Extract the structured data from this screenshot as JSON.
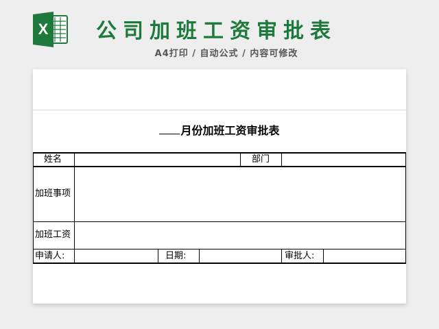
{
  "banner": {
    "title": "公司加班工资审批表",
    "subtitle": "A4打印 / 自动公式 / 内容可修改",
    "logo_letter": "X",
    "brand_color": "#1e7a3c"
  },
  "form": {
    "title": "月份加班工资审批表",
    "row_name": {
      "name_label": "姓名",
      "dept_label": "部门"
    },
    "overtime_matters_label": "加班事项",
    "overtime_pay_label": "加班工资",
    "footer": {
      "applicant_label": "申请人:",
      "date_label": "日期:",
      "approver_label": "审批人:"
    }
  }
}
